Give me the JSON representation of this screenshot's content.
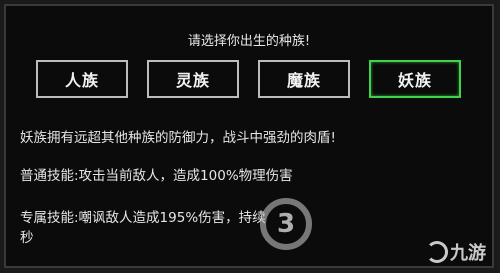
{
  "prompt": "请选择你出生的种族!",
  "races": [
    {
      "label": "人族"
    },
    {
      "label": "灵族"
    },
    {
      "label": "魔族"
    },
    {
      "label": "妖族"
    }
  ],
  "selected_race_index": 3,
  "colors": {
    "selected_border": "#3fd24a",
    "button_border": "#bdbdbd",
    "background": "#0b0b0b"
  },
  "description": {
    "summary": "妖族拥有远超其他种族的防御力，战斗中强劲的肉盾!",
    "common_skill": "普通技能:攻击当前敌人，造成100%物理伤害",
    "exclusive_skill_line1": "专属技能:嘲讽敌人造成195%伤害，持续",
    "exclusive_skill_line2": "秒"
  },
  "watermark": {
    "badge": "3",
    "logo_text": "九游"
  }
}
